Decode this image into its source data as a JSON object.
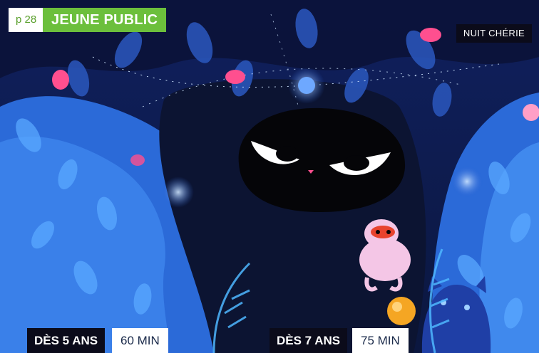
{
  "header": {
    "page_number": "p 28",
    "section": "JEUNE PUBLIC"
  },
  "film_title": "NUIT CHÉRIE",
  "sessions": [
    {
      "age": "DÈS 5 ANS",
      "duration": "60 MIN"
    },
    {
      "age": "DÈS 7 ANS",
      "duration": "75 MIN"
    }
  ],
  "colors": {
    "accent_green": "#6cbf3c",
    "dark": "#0b0b1a",
    "night_blue": "#1a3fa8"
  },
  "illustration": {
    "subject": "dark creature with large eyes in a night forest, pink monkey, blue leaves"
  }
}
